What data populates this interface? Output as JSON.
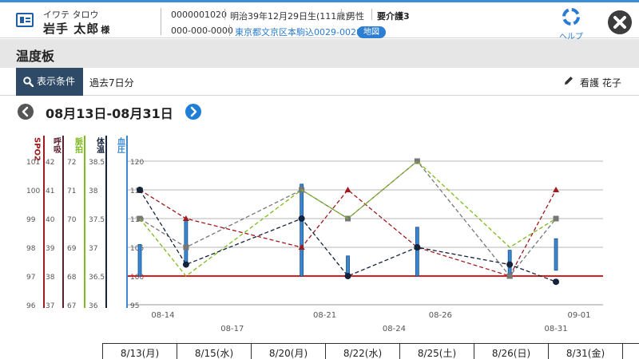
{
  "patient": {
    "name_kana": "イワテ タロウ",
    "name": "岩手 太郎",
    "honorific": "様",
    "id": "0000001020",
    "birth": "明治39年12月29日生(111歳)",
    "sex": "男性",
    "care_level": "要介護3",
    "phone": "000-000-0000",
    "address": "東京都文京区本駒込0029-0028",
    "map_label": "地図"
  },
  "help_label": "ヘルプ",
  "page_title": "温度板",
  "filter": {
    "button_label": "表示条件",
    "value": "過去7日分"
  },
  "nurse_label": "看護 花子",
  "date_range": "08月13日-08月31日",
  "colors": {
    "accent": "#3b8fd6",
    "spo2": "#a0191e",
    "resp": "#5b2130",
    "pulse": "#7fba1f",
    "temp": "#14233b",
    "bp": "#3a87cf",
    "baseline": "#e01b1b"
  },
  "icons": [
    "id-card-icon",
    "help-lifebuoy-icon",
    "close-icon",
    "search-icon",
    "pencil-icon",
    "chevron-left-icon",
    "chevron-right-icon"
  ],
  "chart_data": {
    "type": "line",
    "axes": [
      {
        "label": "SPO2",
        "ticks": [
          "96",
          "97",
          "98",
          "99",
          "100",
          "101"
        ],
        "color": "#a0191e"
      },
      {
        "label": "呼吸",
        "ticks": [
          "37",
          "38",
          "39",
          "40",
          "41",
          "42"
        ],
        "color": "#5b2130"
      },
      {
        "label": "脈拍",
        "ticks": [
          "67",
          "68",
          "69",
          "70",
          "71",
          "72"
        ],
        "color": "#7fba1f"
      },
      {
        "label": "体温",
        "ticks": [
          "36",
          "36.5",
          "37",
          "37.5",
          "38",
          "38.5"
        ],
        "color": "#14233b"
      },
      {
        "label": "血圧",
        "ticks": [
          "95",
          "100",
          "105",
          "110",
          "115",
          "120"
        ],
        "color": "#3a87cf"
      }
    ],
    "x_ticks_top": [
      "08-14",
      "08-21",
      "08-26",
      "09-01"
    ],
    "x_ticks_bottom": [
      "08-17",
      "08-24",
      "08-31"
    ],
    "x_domain": [
      "08-13",
      "09-01"
    ],
    "ylim": [
      95,
      120
    ],
    "baseline_value": 100,
    "x": [
      "08-13",
      "08-15",
      "08-20",
      "08-22",
      "08-25",
      "08-29",
      "08-31"
    ],
    "series": [
      {
        "name": "SPO2",
        "style": "triangle",
        "color": "#a0191e",
        "values": [
          115,
          110,
          105,
          115,
          105,
          100,
          115
        ]
      },
      {
        "name": "呼吸",
        "style": "square",
        "color": "#777777",
        "values": [
          110,
          105,
          115,
          110,
          120,
          100,
          110
        ]
      },
      {
        "name": "脈拍",
        "style": "none",
        "color": "#7fba1f",
        "values": [
          110,
          100,
          115,
          110,
          120,
          105,
          110
        ]
      },
      {
        "name": "体温",
        "style": "dot",
        "color": "#14233b",
        "values": [
          115,
          102,
          110,
          100,
          105,
          102,
          99
        ]
      },
      {
        "name": "血圧",
        "style": "bar",
        "color": "#3a87cf",
        "ranges": [
          [
            100,
            105.5
          ],
          [
            102,
            110
          ],
          [
            100,
            116
          ],
          [
            100,
            103.5
          ],
          [
            100,
            108.5
          ],
          [
            100,
            104.5
          ],
          [
            101,
            106.5
          ]
        ]
      }
    ]
  },
  "date_table": [
    "8/13(月)",
    "8/15(水)",
    "8/20(月)",
    "8/22(水)",
    "8/25(土)",
    "8/26(日)",
    "8/31(金)"
  ]
}
